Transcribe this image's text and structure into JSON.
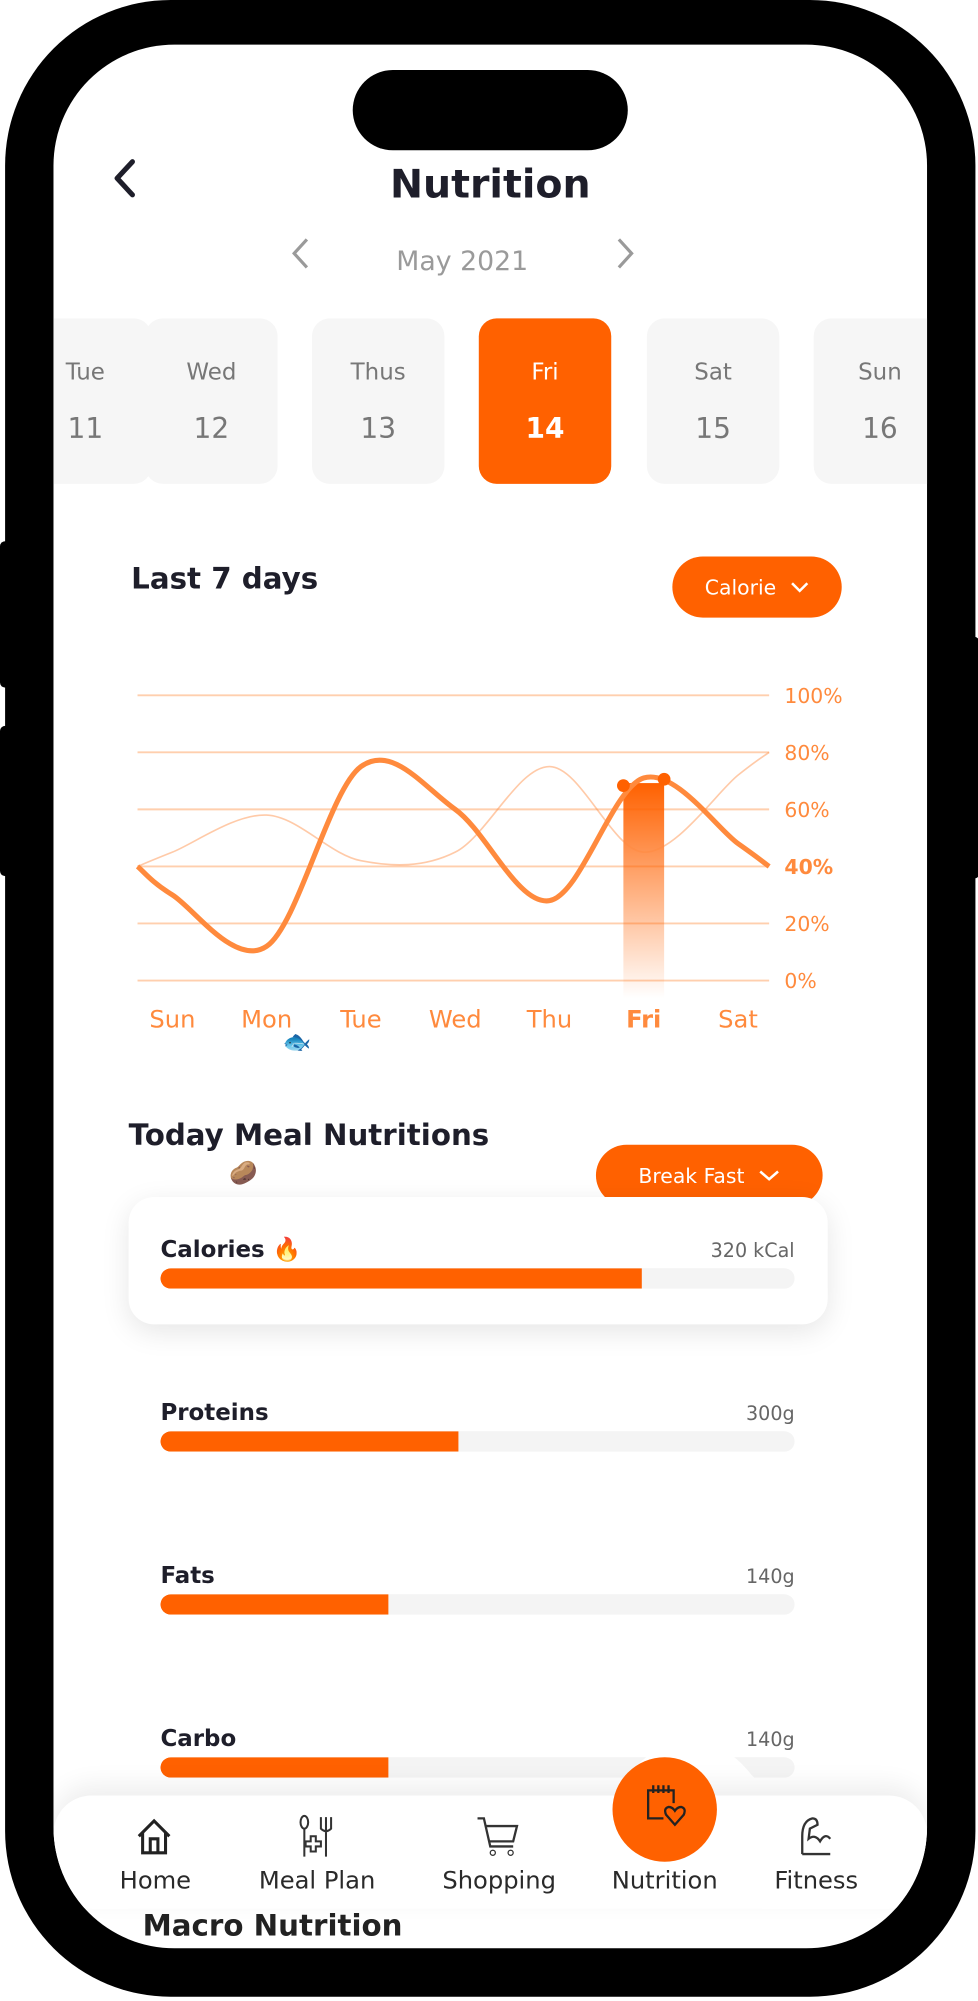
{
  "header": {
    "title": "Nutrition",
    "back_icon": "chevron-left-icon"
  },
  "month": {
    "label": "May 2021",
    "prev_icon": "chevron-left-icon",
    "next_icon": "chevron-right-icon"
  },
  "dates": [
    {
      "day": "Tue",
      "num": "11",
      "selected": false
    },
    {
      "day": "Wed",
      "num": "12",
      "selected": false
    },
    {
      "day": "Thus",
      "num": "13",
      "selected": false
    },
    {
      "day": "Fri",
      "num": "14",
      "selected": true
    },
    {
      "day": "Sat",
      "num": "15",
      "selected": false
    },
    {
      "day": "Sun",
      "num": "16",
      "selected": false
    }
  ],
  "chart_section": {
    "title": "Last 7 days",
    "dropdown": "Calorie"
  },
  "chart_data": {
    "type": "line",
    "categories": [
      "Sun",
      "Mon",
      "Tue",
      "Wed",
      "Thu",
      "Fri",
      "Sat"
    ],
    "highlight_category": "Fri",
    "highlight_tick": "40%",
    "yticks": [
      "0%",
      "20%",
      "40%",
      "60%",
      "80%",
      "100%"
    ],
    "ylim": [
      0,
      100
    ],
    "grid": true,
    "series": [
      {
        "values": [
          30,
          12,
          75,
          60,
          28,
          71,
          48
        ],
        "emphasis": "primary"
      },
      {
        "values": [
          45,
          58,
          42,
          45,
          75,
          45,
          72
        ],
        "emphasis": "faint"
      }
    ],
    "colors": {
      "line": "#ff8a3d",
      "grid": "#ffcfae",
      "accent": "#ff6100"
    }
  },
  "meal": {
    "title": "Today Meal Nutritions",
    "dropdown": "Break Fast",
    "items": [
      {
        "label": "Calories",
        "value": "320 kCal",
        "percent": 76
      },
      {
        "label": "Proteins",
        "value": "300g",
        "percent": 47
      },
      {
        "label": "Fats",
        "value": "140g",
        "percent": 36
      },
      {
        "label": "Carbo",
        "value": "140g",
        "percent": 36
      }
    ],
    "next_section": "Macro Nutrition"
  },
  "nav": {
    "items": [
      {
        "label": "Home",
        "icon": "home-icon"
      },
      {
        "label": "Meal Plan",
        "icon": "meal-plan-icon"
      },
      {
        "label": "Shopping",
        "icon": "cart-icon"
      },
      {
        "label": "Nutrition",
        "icon": "calendar-heart-icon",
        "active": true
      },
      {
        "label": "Fitness",
        "icon": "muscle-arm-icon"
      }
    ]
  }
}
